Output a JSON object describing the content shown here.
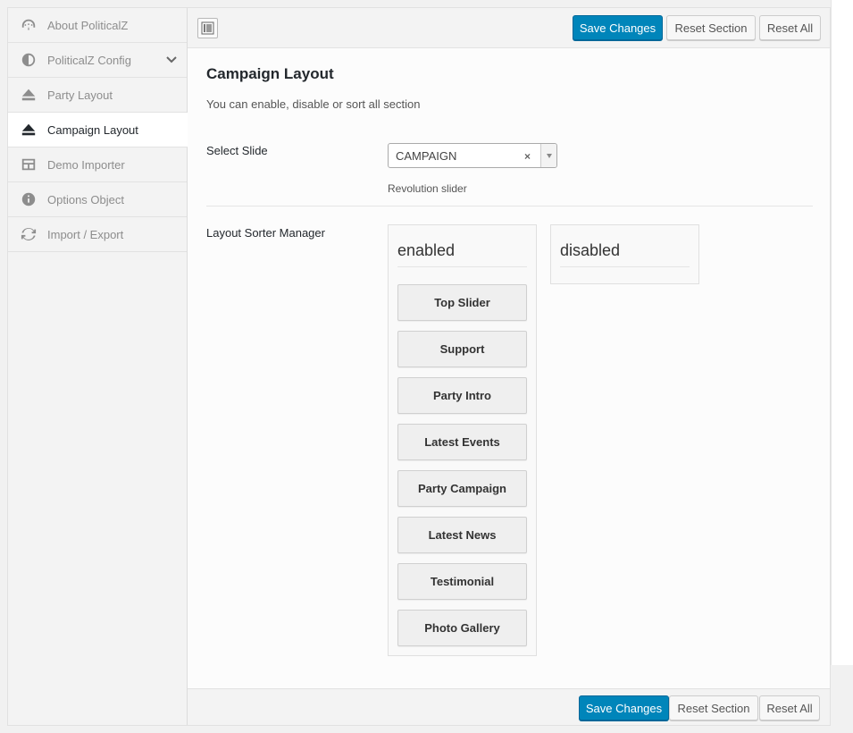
{
  "sidebar": {
    "items": [
      {
        "label": "About PoliticalZ",
        "icon": "dashboard-icon"
      },
      {
        "label": "PoliticalZ Config",
        "icon": "contrast-icon"
      },
      {
        "label": "Party Layout",
        "icon": "eject-icon"
      },
      {
        "label": "Campaign Layout",
        "icon": "eject-icon"
      },
      {
        "label": "Demo Importer",
        "icon": "layout-icon"
      },
      {
        "label": "Options Object",
        "icon": "info-icon"
      },
      {
        "label": "Import / Export",
        "icon": "refresh-icon"
      }
    ],
    "active": "Campaign Layout"
  },
  "toolbar": {
    "save_label": "Save Changes",
    "reset_section_label": "Reset Section",
    "reset_all_label": "Reset All"
  },
  "section": {
    "title": "Campaign Layout",
    "description": "You can enable, disable or sort all section"
  },
  "select_slide": {
    "label": "Select Slide",
    "value": "CAMPAIGN",
    "clear": "×",
    "description": "Revolution slider"
  },
  "sorter": {
    "label": "Layout Sorter Manager",
    "enabled_title": "enabled",
    "disabled_title": "disabled",
    "enabled_items": [
      "Top Slider",
      "Support",
      "Party Intro",
      "Latest Events",
      "Party Campaign",
      "Latest News",
      "Testimonial",
      "Photo Gallery"
    ],
    "disabled_items": []
  },
  "colors": {
    "primary": "#0085ba",
    "sidebar_bg": "#f3f3f3",
    "active_text": "#23282d"
  }
}
